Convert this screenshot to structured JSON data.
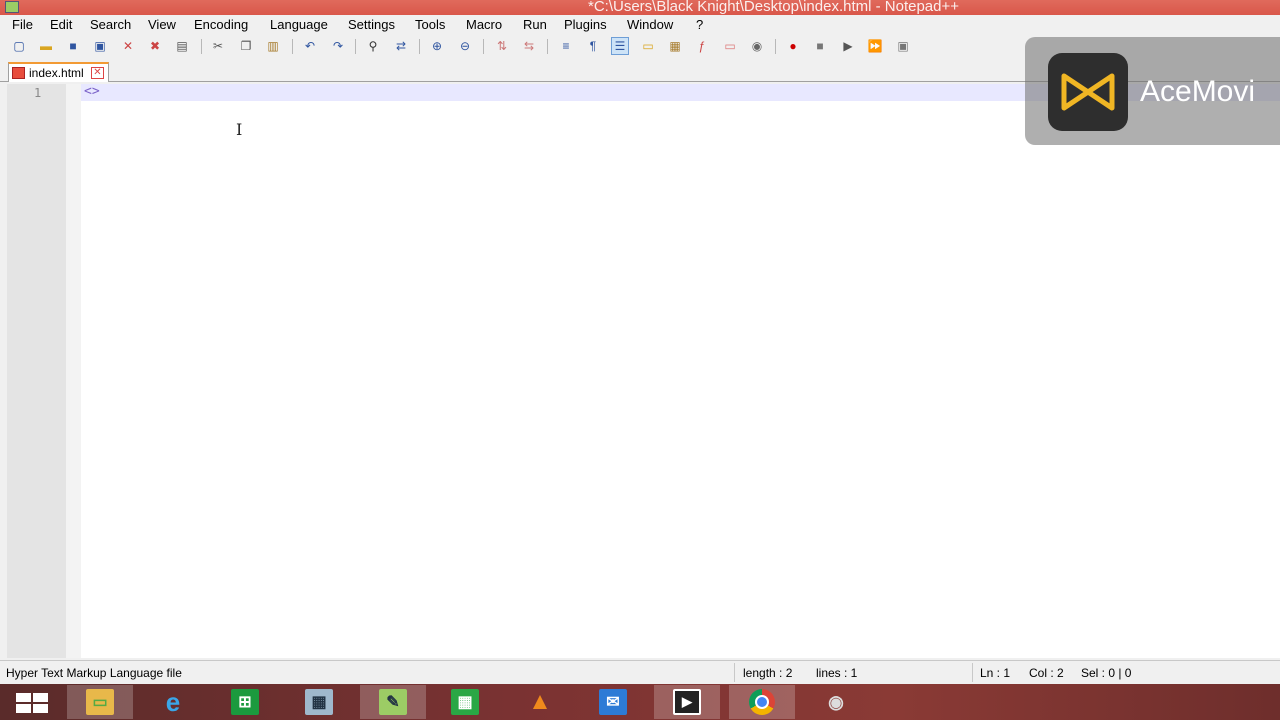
{
  "window": {
    "title": "*C:\\Users\\Black Knight\\Desktop\\index.html - Notepad++"
  },
  "menu": [
    "File",
    "Edit",
    "Search",
    "View",
    "Encoding",
    "Language",
    "Settings",
    "Tools",
    "Macro",
    "Run",
    "Plugins",
    "Window",
    "?"
  ],
  "toolbar": {
    "icons": [
      "new-file-icon",
      "open-file-icon",
      "save-icon",
      "save-all-icon",
      "close-icon",
      "close-all-icon",
      "print-icon",
      "cut-icon",
      "copy-icon",
      "paste-icon",
      "undo-icon",
      "redo-icon",
      "find-icon",
      "replace-icon",
      "zoom-in-icon",
      "zoom-out-icon",
      "sync-vertical-icon",
      "sync-horizontal-icon",
      "word-wrap-icon",
      "show-all-characters-icon",
      "indent-guide-icon",
      "user-defined-language-icon",
      "document-map-icon",
      "function-list-icon",
      "folder-as-workspace-icon",
      "monitoring-icon",
      "record-macro-icon",
      "stop-recording-icon",
      "playback-macro-icon",
      "run-macro-multiple-icon",
      "save-macro-icon"
    ]
  },
  "tab": {
    "label": "index.html"
  },
  "editor": {
    "line_number": "1",
    "line_text": "<>"
  },
  "status": {
    "file_type": "Hyper Text Markup Language file",
    "length": "length : 2",
    "lines": "lines : 1",
    "ln": "Ln : 1",
    "col": "Col : 2",
    "sel": "Sel : 0 | 0"
  },
  "taskbar": {
    "apps": [
      "file-explorer-icon",
      "internet-explorer-icon",
      "store-icon",
      "calculator-icon",
      "notepad-plus-plus-icon",
      "spreadsheet-icon",
      "vlc-icon",
      "mail-icon",
      "video-call-icon",
      "chrome-icon",
      "recorder-icon"
    ]
  },
  "watermark": {
    "text": "AceMovi"
  }
}
